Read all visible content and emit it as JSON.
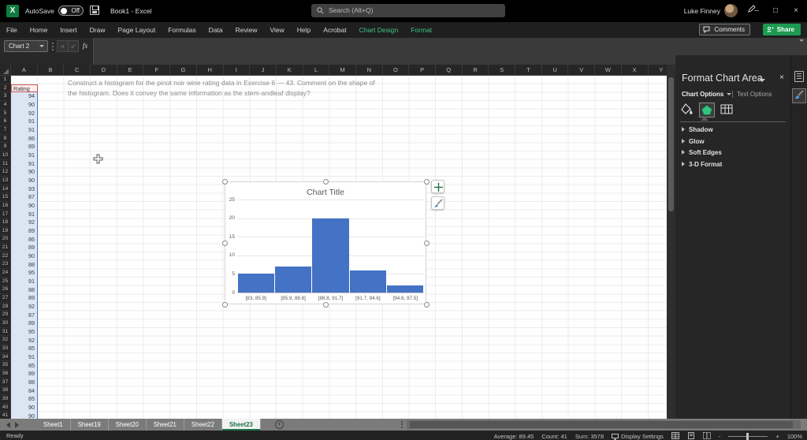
{
  "titlebar": {
    "logo_letter": "X",
    "autosave_label": "AutoSave",
    "autosave_state": "Off",
    "workbook_title": "Book1 - Excel",
    "search_placeholder": "Search (Alt+Q)",
    "user_name": "Luke Finney"
  },
  "glyphs": {
    "minimize": "–",
    "restore": "□",
    "close": "×",
    "panel_close": "×",
    "cancel": "×",
    "enter": "✓",
    "fx": "fx",
    "add_sheet": "+",
    "zoom_out": "-",
    "zoom_in": "+"
  },
  "ribbon": {
    "tabs": [
      {
        "label": "File",
        "contextual": false
      },
      {
        "label": "Home",
        "contextual": false
      },
      {
        "label": "Insert",
        "contextual": false
      },
      {
        "label": "Draw",
        "contextual": false
      },
      {
        "label": "Page Layout",
        "contextual": false
      },
      {
        "label": "Formulas",
        "contextual": false
      },
      {
        "label": "Data",
        "contextual": false
      },
      {
        "label": "Review",
        "contextual": false
      },
      {
        "label": "View",
        "contextual": false
      },
      {
        "label": "Help",
        "contextual": false
      },
      {
        "label": "Acrobat",
        "contextual": false
      },
      {
        "label": "Chart Design",
        "contextual": true
      },
      {
        "label": "Format",
        "contextual": true
      }
    ],
    "comments_label": "Comments",
    "share_label": "Share"
  },
  "formula_row": {
    "name_box_value": "Chart 2"
  },
  "grid": {
    "column_headers": [
      "A",
      "B",
      "C",
      "D",
      "E",
      "F",
      "G",
      "H",
      "I",
      "J",
      "K",
      "L",
      "M",
      "N",
      "O",
      "P",
      "Q",
      "R",
      "S",
      "T",
      "U",
      "V",
      "W",
      "X",
      "Y"
    ],
    "visible_row_count": 41,
    "note_line1": "Construct a histogram for the pinot noir wine rating data in Exercise 6 — 43. Comment on the shape of",
    "note_line2": "the histogram. Does it convey the same information as the stem-andleaf display?",
    "header_cell": "Rating",
    "values": [
      94,
      90,
      92,
      91,
      91,
      86,
      89,
      91,
      91,
      90,
      90,
      93,
      87,
      90,
      91,
      92,
      89,
      86,
      89,
      90,
      88,
      95,
      91,
      88,
      89,
      92,
      87,
      89,
      95,
      92,
      85,
      91,
      85,
      89,
      88,
      84,
      85,
      90,
      90
    ]
  },
  "chart_data": {
    "type": "bar",
    "title": "Chart Title",
    "categories": [
      "[83, 85.9]",
      "[85.9, 88.8]",
      "[88.8, 91.7]",
      "[91.7, 94.6]",
      "[94.6, 97.5]"
    ],
    "values": [
      5,
      7,
      20,
      6,
      2
    ],
    "xlabel": "",
    "ylabel": "",
    "ylim": [
      0,
      25
    ],
    "yticks": [
      0,
      5,
      10,
      15,
      20,
      25
    ],
    "bar_color": "#4472c4",
    "grid": true,
    "legend": false
  },
  "panel": {
    "title": "Format Chart Area",
    "tab_chart_options": "Chart Options",
    "tab_text_options": "Text Options",
    "sections": [
      "Shadow",
      "Glow",
      "Soft Edges",
      "3-D Format"
    ]
  },
  "sheet_bar": {
    "tabs": [
      "Sheet1",
      "Sheet19",
      "Sheet20",
      "Sheet21",
      "Sheet22",
      "Sheet23"
    ],
    "active_tab": "Sheet23"
  },
  "status_bar": {
    "mode": "Ready",
    "average_label": "Average: 89.45",
    "count_label": "Count: 41",
    "sum_label": "Sum: 3578",
    "display_settings_label": "Display Settings",
    "zoom_label": "100%"
  }
}
